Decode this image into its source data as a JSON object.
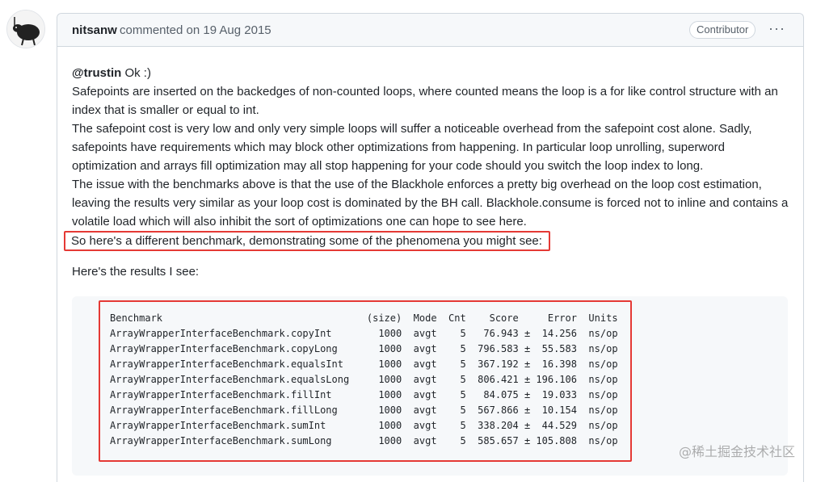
{
  "comment": {
    "author": "nitsanw",
    "meta": "commented on 19 Aug 2015",
    "badge": "Contributor",
    "more": "···",
    "mention": "@trustin",
    "greeting": " Ok :)",
    "paragraphs": [
      "Safepoints are inserted on the backedges of non-counted loops, where counted means the loop is a for like control structure with an index that is smaller or equal to int.",
      "The safepoint cost is very low and only very simple loops will suffer a noticeable overhead from the safepoint cost alone. Sadly, safepoints have requirements which may block other optimizations from happening. In particular loop unrolling, superword optimization and arrays fill optimization may all stop happening for your code should you switch the loop index to long.",
      "The issue with the benchmarks above is that the use of the Blackhole enforces a pretty big overhead on the loop cost estimation, leaving the results very similar as your loop cost is dominated by the BH call. Blackhole.consume is forced not to inline and contains a volatile load which will also inhibit the sort of optimizations one can hope to see here."
    ],
    "highlighted_line": "So here's a different benchmark, demonstrating some of the phenomena you might see:",
    "results_label": "Here's the results I see:",
    "code_lines": [
      "Benchmark                                   (size)  Mode  Cnt    Score     Error  Units",
      "ArrayWrapperInterfaceBenchmark.copyInt        1000  avgt    5   76.943 ±  14.256  ns/op",
      "ArrayWrapperInterfaceBenchmark.copyLong       1000  avgt    5  796.583 ±  55.583  ns/op",
      "ArrayWrapperInterfaceBenchmark.equalsInt      1000  avgt    5  367.192 ±  16.398  ns/op",
      "ArrayWrapperInterfaceBenchmark.equalsLong     1000  avgt    5  806.421 ± 196.106  ns/op",
      "ArrayWrapperInterfaceBenchmark.fillInt        1000  avgt    5   84.075 ±  19.033  ns/op",
      "ArrayWrapperInterfaceBenchmark.fillLong       1000  avgt    5  567.866 ±  10.154  ns/op",
      "ArrayWrapperInterfaceBenchmark.sumInt         1000  avgt    5  338.204 ±  44.529  ns/op",
      "ArrayWrapperInterfaceBenchmark.sumLong        1000  avgt    5  585.657 ± 105.808  ns/op"
    ]
  },
  "watermark": "@稀土掘金技术社区",
  "colors": {
    "highlight": "#e53935",
    "border": "#d0d7de",
    "header_bg": "#f6f8fa",
    "code_bg": "#f6f8fa"
  }
}
